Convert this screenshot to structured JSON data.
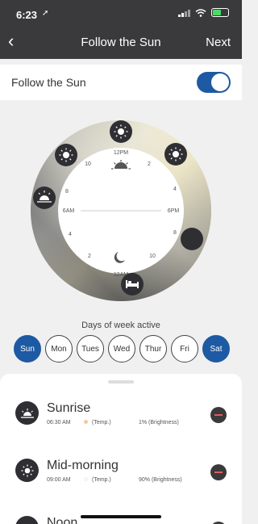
{
  "status": {
    "time": "6:23",
    "location_arrow": "➚"
  },
  "nav": {
    "back_icon": "chevron-left",
    "title": "Follow the Sun",
    "next_label": "Next"
  },
  "toggle": {
    "label": "Follow the Sun",
    "on": true
  },
  "dial": {
    "labels": {
      "top": "12PM",
      "bottom": "12AM",
      "left": "6AM",
      "right": "6PM",
      "h10_left": "10",
      "h2_right": "2",
      "h8_left": "8",
      "h4_right": "4",
      "h4_left": "4",
      "h8_right": "8",
      "h2_left": "2",
      "h10_right": "10"
    },
    "markers": [
      "sun-icon",
      "sun-icon",
      "sun-icon",
      "sunrise-icon",
      "moon-icon",
      "bed-icon"
    ]
  },
  "days": {
    "title": "Days of week active",
    "items": [
      {
        "label": "Sun",
        "active": true
      },
      {
        "label": "Mon",
        "active": false
      },
      {
        "label": "Tues",
        "active": false
      },
      {
        "label": "Wed",
        "active": false
      },
      {
        "label": "Thur",
        "active": false
      },
      {
        "label": "Fri",
        "active": false
      },
      {
        "label": "Sat",
        "active": true
      }
    ]
  },
  "schedule": [
    {
      "name": "Sunrise",
      "time": "06:30 AM",
      "temp": "(Temp.)",
      "brightness": "1%  (Brightness)",
      "dot_color": "#f2c9a0",
      "icon": "sunrise-icon"
    },
    {
      "name": "Mid-morning",
      "time": "09:00 AM",
      "temp": "(Temp.)",
      "brightness": "90%  (Brightness)",
      "dot_color": "#ffffff",
      "icon": "sun-icon"
    },
    {
      "name": "Noon",
      "icon": "sun-icon"
    }
  ],
  "colors": {
    "accent": "#1d5aa3",
    "dark": "#3a3a3c"
  }
}
